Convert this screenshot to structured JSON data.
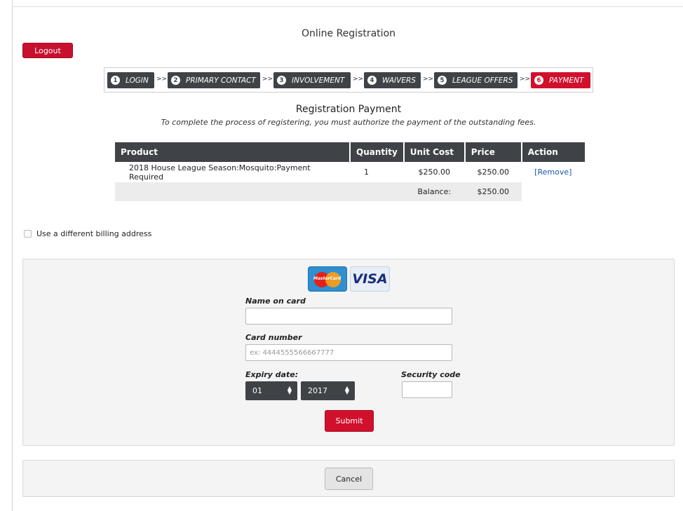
{
  "page": {
    "title": "Online Registration"
  },
  "header": {
    "logout_label": "Logout"
  },
  "steps": [
    {
      "num": "1",
      "label": "LOGIN",
      "active": false
    },
    {
      "num": "2",
      "label": "PRIMARY CONTACT",
      "active": false
    },
    {
      "num": "3",
      "label": "INVOLVEMENT",
      "active": false
    },
    {
      "num": "4",
      "label": "WAIVERS",
      "active": false
    },
    {
      "num": "5",
      "label": "LEAGUE OFFERS",
      "active": false
    },
    {
      "num": "6",
      "label": "PAYMENT",
      "active": true
    }
  ],
  "step_separator": ">>",
  "payment": {
    "heading": "Registration Payment",
    "subheading": "To complete the process of registering, you must authorize the payment of the outstanding fees."
  },
  "table": {
    "columns": [
      "Product",
      "Quantity",
      "Unit Cost",
      "Price",
      "Action"
    ],
    "rows": [
      {
        "product": "2018 House League Season:Mosquito:Payment Required",
        "quantity": "1",
        "unit_cost": "$250.00",
        "price": "$250.00",
        "action": "[Remove]"
      }
    ],
    "balance_label": "Balance:",
    "balance_value": "$250.00"
  },
  "billing": {
    "label": "Use a different billing address",
    "checked": false
  },
  "card": {
    "logos": [
      "MasterCard",
      "VISA"
    ],
    "name_label": "Name on card",
    "name_value": "",
    "number_label": "Card number",
    "number_placeholder": "ex: 4444555566667777",
    "expiry_label": "Expiry date:",
    "expiry_month": "01",
    "expiry_year": "2017",
    "security_label": "Security code",
    "security_value": "",
    "submit_label": "Submit"
  },
  "footer": {
    "cancel_label": "Cancel"
  },
  "colors": {
    "accent": "#d0102c",
    "dark": "#3f4246",
    "link": "#1e57a6"
  }
}
